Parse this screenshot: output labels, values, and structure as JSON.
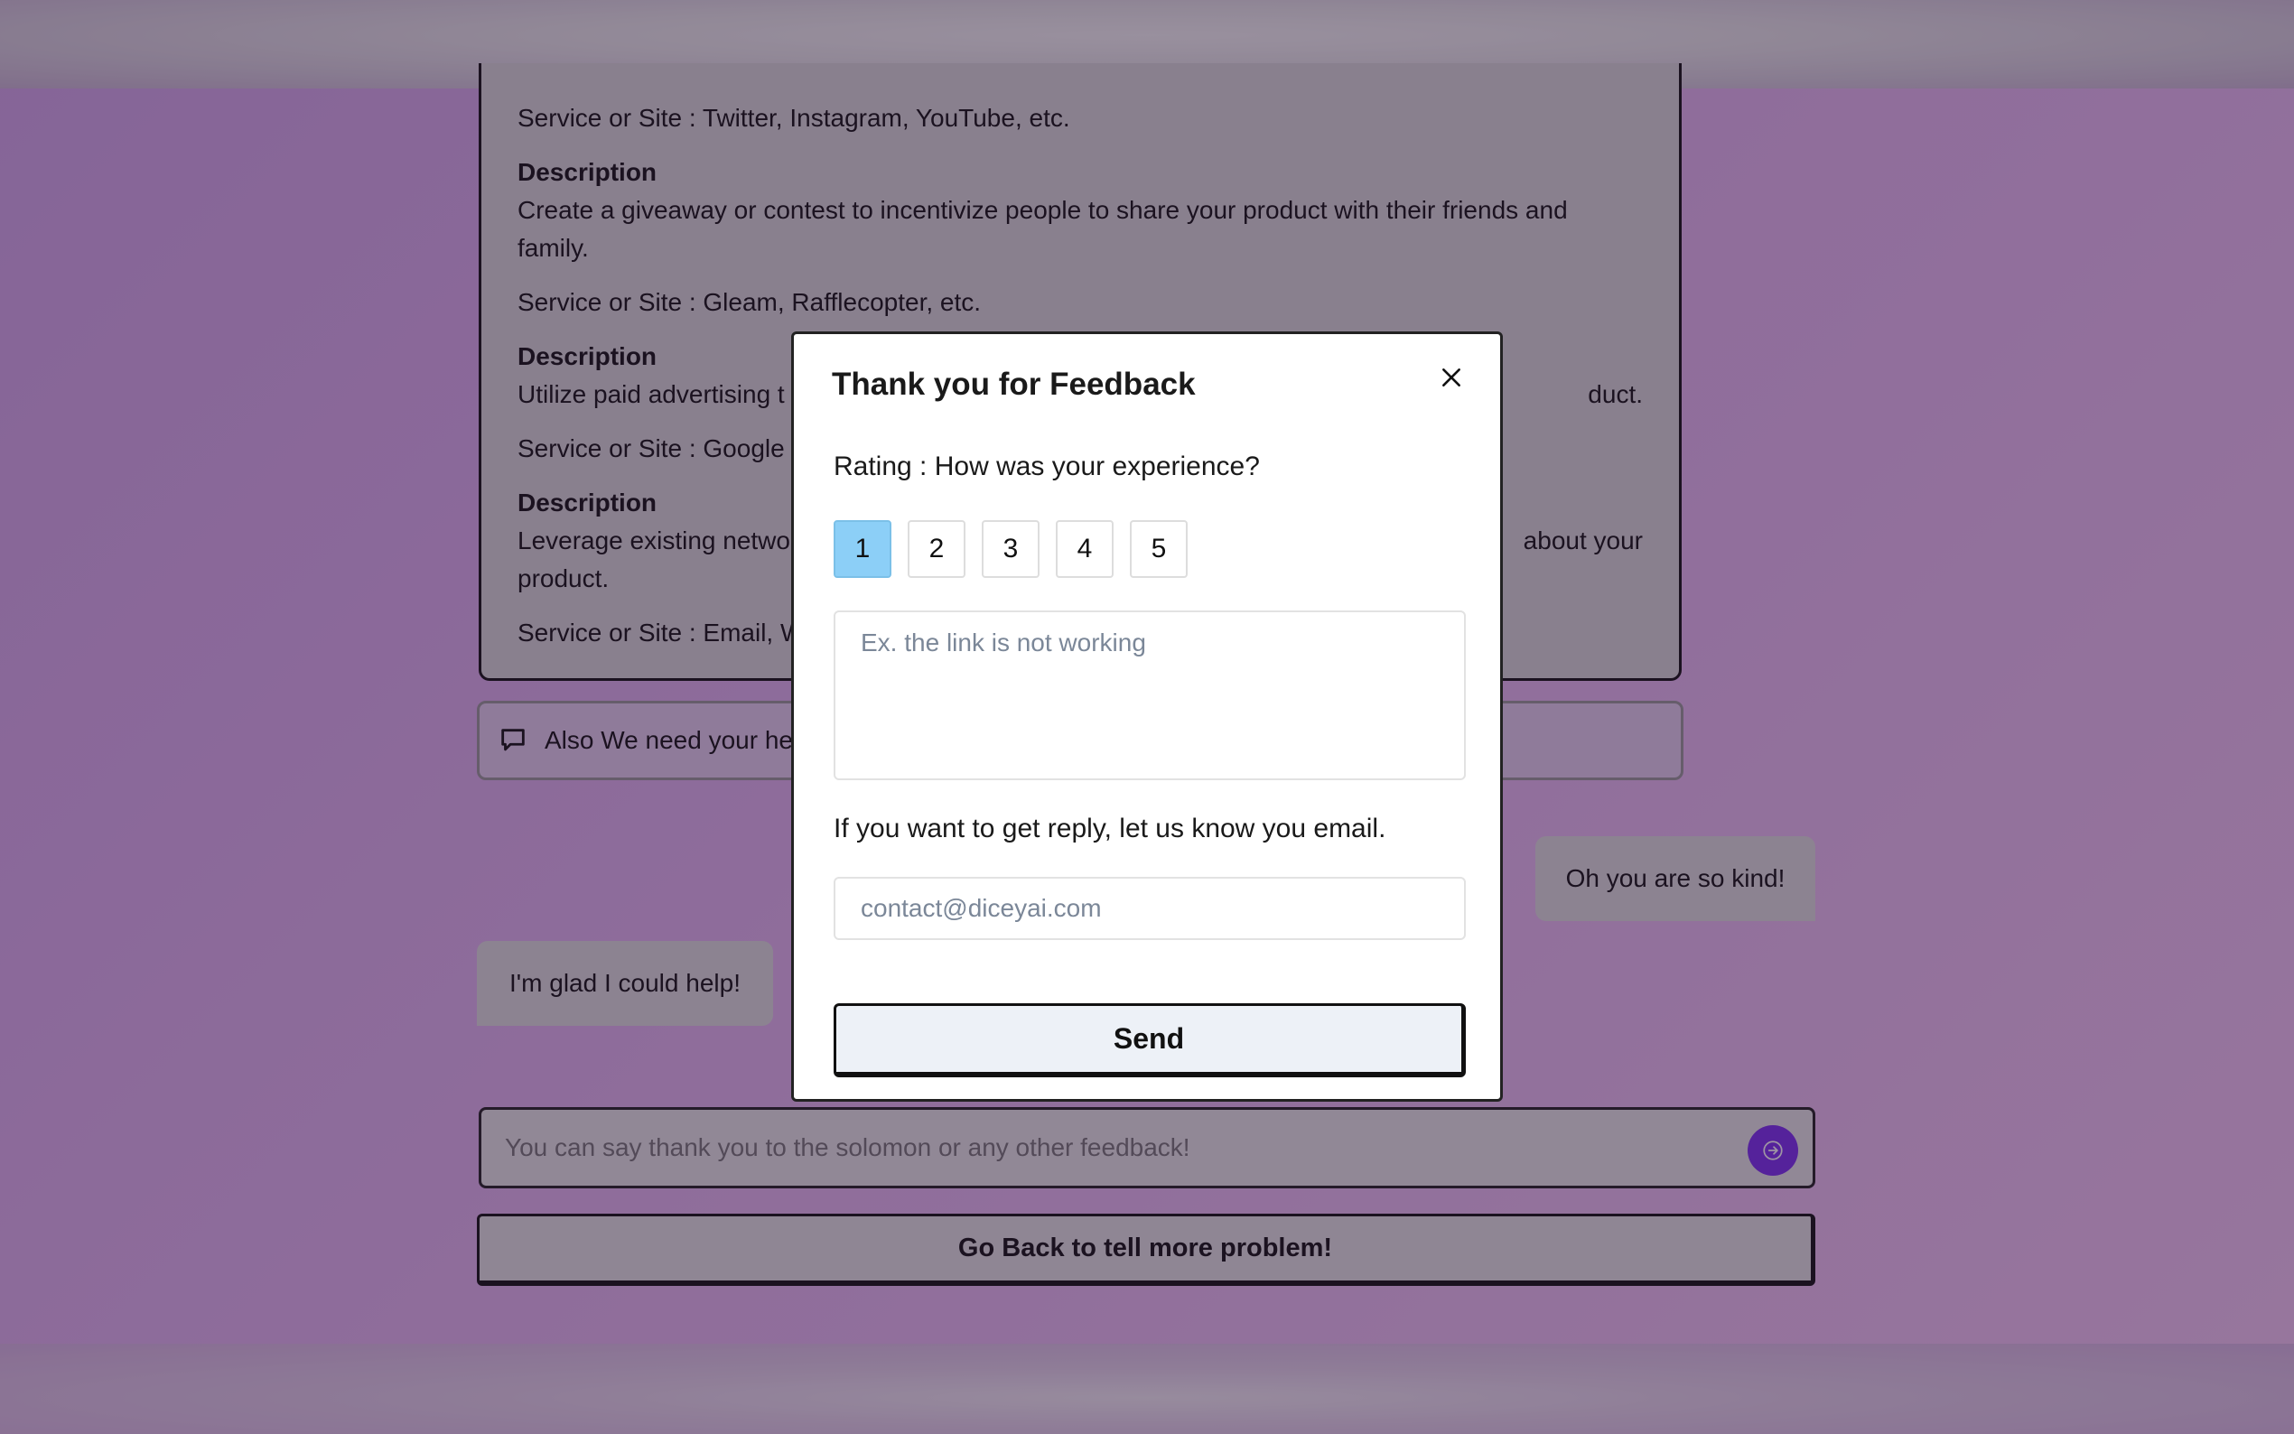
{
  "page": {
    "content_card": {
      "blocks": [
        {
          "kind": "line",
          "text": "Service or Site : Twitter, Instagram, YouTube, etc."
        },
        {
          "kind": "heading",
          "text": "Description"
        },
        {
          "kind": "line",
          "text": "Create a giveaway or contest to incentivize people to share your product with their friends and"
        },
        {
          "kind": "line",
          "text": "family."
        },
        {
          "kind": "line",
          "text": "Service or Site : Gleam, Rafflecopter, etc."
        },
        {
          "kind": "heading",
          "text": "Description"
        },
        {
          "kind": "line",
          "text": "Utilize paid advertising t"
        },
        {
          "kind": "line",
          "text": "Service or Site : Google"
        },
        {
          "kind": "heading",
          "text": "Description"
        },
        {
          "kind": "line",
          "text": "Leverage existing netwo"
        },
        {
          "kind": "line",
          "text": "product."
        },
        {
          "kind": "line",
          "text": "Service or Site : Email, W"
        }
      ],
      "right_fragments": {
        "line_paid": "duct.",
        "line_leverage": "about your"
      }
    },
    "notice": {
      "icon": "chat-bubble-icon",
      "text": "Also We need your hel"
    },
    "bubbles": {
      "user": "Oh you are so kind!",
      "bot": "I'm glad I could help!"
    },
    "chat_input": {
      "placeholder": "You can say thank you to the solomon or any other feedback!",
      "send_icon": "arrow-right-icon"
    },
    "go_back_button": "Go Back to tell more problem!"
  },
  "modal": {
    "title": "Thank you for Feedback",
    "close_icon": "close-icon",
    "rating_label": "Rating : How was your experience?",
    "ratings": [
      "1",
      "2",
      "3",
      "4",
      "5"
    ],
    "selected_rating": "1",
    "feedback_placeholder": "Ex. the link is not working",
    "email_label": "If you want to get reply, let us know you email.",
    "email_placeholder": "contact@diceyai.com",
    "send_label": "Send"
  },
  "colors": {
    "accent_purple": "#7b2ff0",
    "rating_selected": "#8ccff7"
  }
}
